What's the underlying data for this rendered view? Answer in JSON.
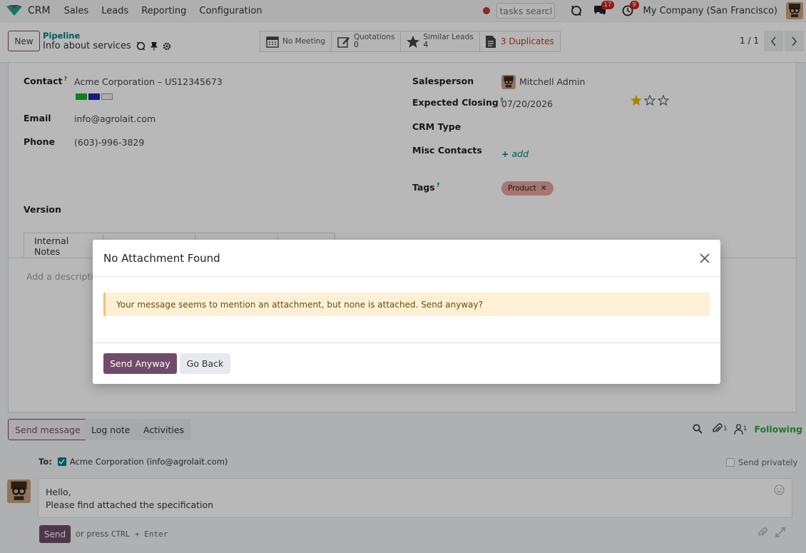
{
  "navbar": {
    "app_name": "CRM",
    "menu": [
      "Sales",
      "Leads",
      "Reporting",
      "Configuration"
    ],
    "tasks_search_placeholder": "tasks search",
    "messages_count": "17",
    "activities_count": "9",
    "company": "My Company (San Francisco)"
  },
  "control_panel": {
    "new_label": "New",
    "breadcrumb_parent": "Pipeline",
    "record_title": "Info about services",
    "smart_buttons": {
      "meeting": "No Meeting",
      "quotations_label": "Quotations",
      "quotations_count": "0",
      "similar_label": "Similar Leads",
      "similar_count": "4",
      "duplicates": "3 Duplicates"
    },
    "pager": "1 / 1"
  },
  "form": {
    "contact_label": "Contact",
    "contact_value": "Acme Corporation – US12345673",
    "email_label": "Email",
    "email_value": "info@agrolait.com",
    "phone_label": "Phone",
    "phone_value": "(603)-996-3829",
    "version_label": "Version",
    "salesperson_label": "Salesperson",
    "salesperson_value": "Mitchell Admin",
    "expected_closing_label": "Expected Closing",
    "expected_closing_value": "07/20/2026",
    "priority_stars": 1,
    "crm_type_label": "CRM Type",
    "misc_contacts_label": "Misc Contacts",
    "misc_add": "add",
    "tags_label": "Tags",
    "tag_product": "Product",
    "help_mark": "?",
    "tab_internal_notes": "Internal Notes",
    "description_placeholder": "Add a description..."
  },
  "chatter": {
    "send_message": "Send message",
    "log_note": "Log note",
    "activities": "Activities",
    "attachments_count": "1",
    "followers_count": "1",
    "following": "Following",
    "to_label": "To:",
    "recipient": "Acme Corporation (info@agrolait.com)",
    "send_privately": "Send privately",
    "message_line1": "Hello,",
    "message_line2": "Please find attached the specification",
    "send_label": "Send",
    "hint_prefix": "or press",
    "hint_keys": "CTRL + Enter"
  },
  "modal": {
    "title": "No Attachment Found",
    "message": "Your message seems to mention an attachment, but none is attached. Send anyway?",
    "primary": "Send Anyway",
    "secondary": "Go Back"
  },
  "colors": {
    "brand": "#714b67",
    "accent": "#017e84",
    "alert_bg": "#fdf0d5",
    "tag_bg": "#e8a29c"
  }
}
